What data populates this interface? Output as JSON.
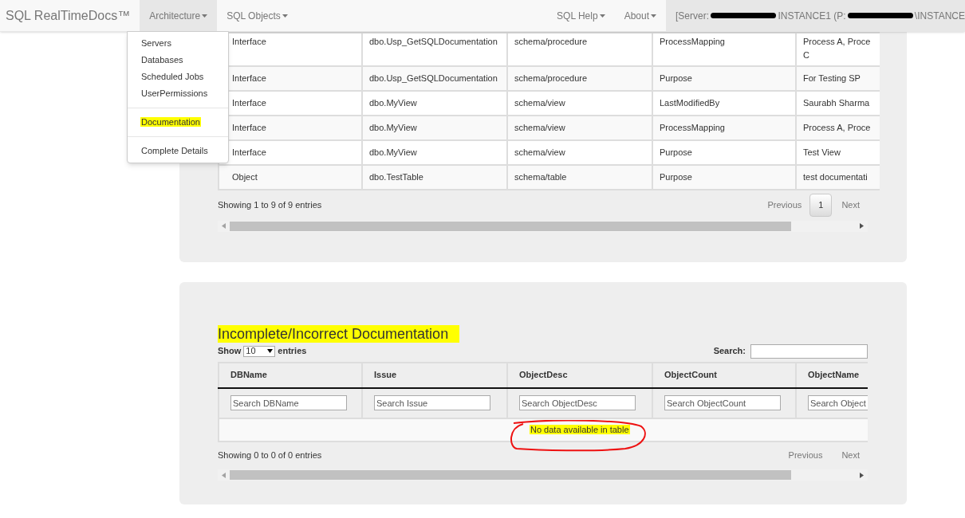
{
  "navbar": {
    "brand": "SQL RealTimeDocs™",
    "menus": [
      {
        "label": "Architecture",
        "selected": true
      },
      {
        "label": "SQL Objects",
        "selected": false
      }
    ],
    "right_menus": [
      {
        "label": "SQL Help"
      },
      {
        "label": "About"
      }
    ],
    "server_segments": [
      "[Server:",
      "INSTANCE1 (P:",
      "\\INSTANCE"
    ]
  },
  "dropdown": {
    "items": [
      {
        "kind": "item",
        "label": "Servers",
        "highlighted": false
      },
      {
        "kind": "item",
        "label": "Databases",
        "highlighted": false
      },
      {
        "kind": "item",
        "label": "Scheduled Jobs",
        "highlighted": false
      },
      {
        "kind": "item",
        "label": "UserPermissions",
        "highlighted": false
      },
      {
        "kind": "divider"
      },
      {
        "kind": "item",
        "label": "Documentation",
        "highlighted": true
      },
      {
        "kind": "divider"
      },
      {
        "kind": "item",
        "label": "Complete Details",
        "highlighted": false
      }
    ]
  },
  "top_table": {
    "rows": [
      [
        "Interface",
        "dbo.Usp_GetSQLDocumentation",
        "schema/procedure",
        "ProcessMapping",
        "Process A, Proce\nC"
      ],
      [
        "Interface",
        "dbo.Usp_GetSQLDocumentation",
        "schema/procedure",
        "Purpose",
        "For Testing SP"
      ],
      [
        "Interface",
        "dbo.MyView",
        "schema/view",
        "LastModifiedBy",
        "Saurabh Sharma"
      ],
      [
        "Interface",
        "dbo.MyView",
        "schema/view",
        "ProcessMapping",
        "Process A, Proce"
      ],
      [
        "Interface",
        "dbo.MyView",
        "schema/view",
        "Purpose",
        "Test View"
      ],
      [
        "Object",
        "dbo.TestTable",
        "schema/table",
        "Purpose",
        "test documentati"
      ]
    ],
    "info": "Showing 1 to 9 of 9 entries",
    "pagination": {
      "previous": "Previous",
      "pages": [
        {
          "label": "1",
          "selected": true
        }
      ],
      "next": "Next"
    }
  },
  "bottom_section": {
    "title": "Incomplete/Incorrect Documentation",
    "show_label": "Show",
    "page_size": "10",
    "entries_label": "entries",
    "search_label": "Search:",
    "columns": [
      {
        "name": "DBName",
        "placeholder": "Search DBName"
      },
      {
        "name": "Issue",
        "placeholder": "Search Issue"
      },
      {
        "name": "ObjectDesc",
        "placeholder": "Search ObjectDesc"
      },
      {
        "name": "ObjectCount",
        "placeholder": "Search ObjectCount"
      },
      {
        "name": "ObjectName",
        "placeholder": "Search Object"
      }
    ],
    "empty_message": "No data available in table",
    "info": "Showing 0 to 0 of 0 entries",
    "pagination": {
      "previous": "Previous",
      "next": "Next"
    }
  }
}
